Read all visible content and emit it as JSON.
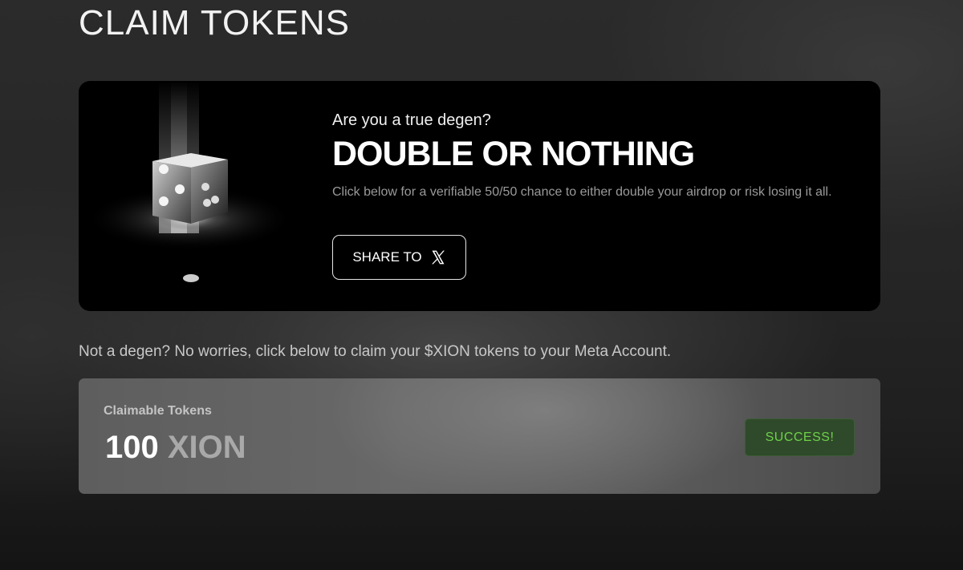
{
  "page": {
    "title": "CLAIM TOKENS"
  },
  "promo": {
    "eyebrow": "Are you a true degen?",
    "heading": "DOUBLE OR NOTHING",
    "description": "Click below for a verifiable 50/50 chance to either double your airdrop or risk losing it all.",
    "share_label": "SHARE TO",
    "share_icon": "x-logo-icon",
    "image": "dice-icon"
  },
  "hint": "Not a degen? No worries, click below to claim your $XION tokens to your Meta Account.",
  "claim": {
    "label": "Claimable Tokens",
    "amount": "100",
    "unit": "XION",
    "status": "SUCCESS!"
  },
  "colors": {
    "success_text": "#6ed14a",
    "success_bg": "#2f4a2a"
  }
}
